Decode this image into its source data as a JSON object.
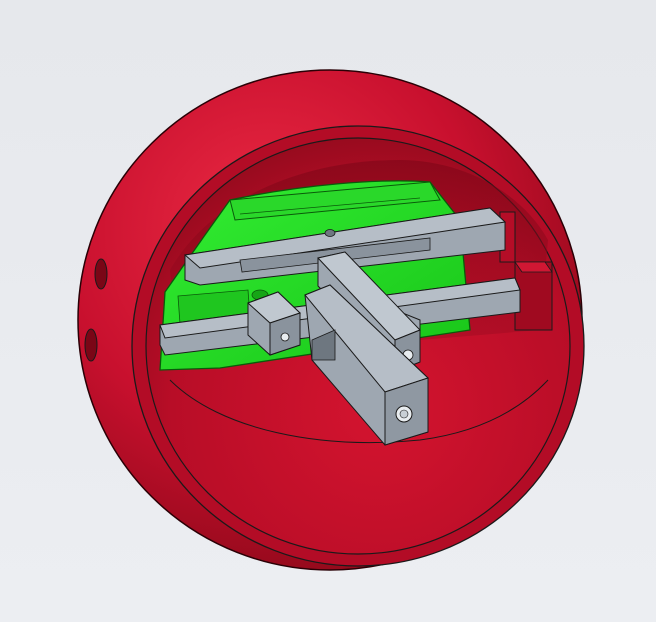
{
  "viewport": {
    "background": "#e8eaee"
  },
  "model": {
    "parts": [
      {
        "name": "sphere-shell",
        "color": "#c8102e"
      },
      {
        "name": "circuit-board",
        "color": "#22dd22"
      },
      {
        "name": "gray-frame",
        "color": "#9aa3ad"
      }
    ]
  },
  "colors": {
    "shell_light": "#e0203a",
    "shell_mid": "#c8102e",
    "shell_dark": "#7a0616",
    "board": "#22dd22",
    "board_dark": "#0f8a0f",
    "frame": "#9ea7b1",
    "frame_dark": "#6e7780",
    "edge": "#1a1a1a"
  }
}
